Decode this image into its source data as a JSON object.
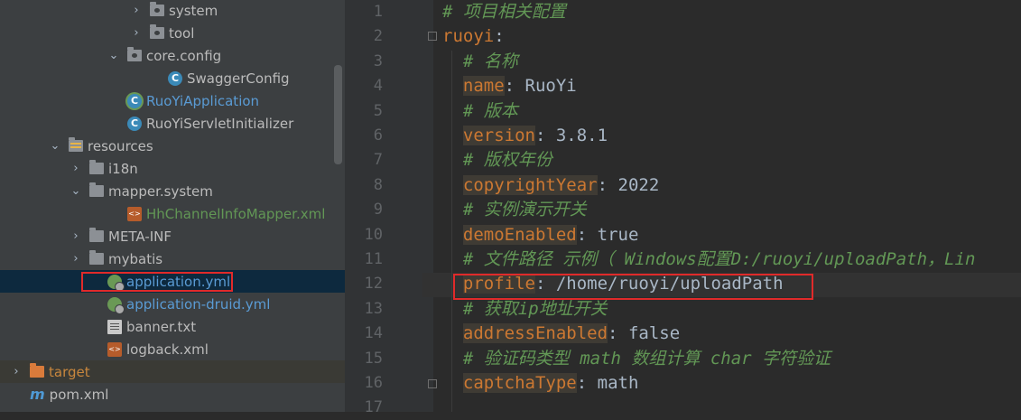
{
  "project_tree": {
    "items": [
      {
        "label": "system",
        "kind": "pkg",
        "arrow": "›",
        "style": ""
      },
      {
        "label": "tool",
        "kind": "pkg",
        "arrow": "›",
        "style": ""
      },
      {
        "label": "core.config",
        "kind": "pkg",
        "arrow": "⌄",
        "style": ""
      },
      {
        "label": "SwaggerConfig",
        "kind": "cls",
        "arrow": "",
        "style": ""
      },
      {
        "label": "RuoYiApplication",
        "kind": "spring-cls",
        "arrow": "",
        "style": "blue"
      },
      {
        "label": "RuoYiServletInitializer",
        "kind": "cls",
        "arrow": "",
        "style": ""
      },
      {
        "label": "resources",
        "kind": "res",
        "arrow": "⌄",
        "style": ""
      },
      {
        "label": "i18n",
        "kind": "folder",
        "arrow": "›",
        "style": ""
      },
      {
        "label": "mapper.system",
        "kind": "folder",
        "arrow": "⌄",
        "style": ""
      },
      {
        "label": "HhChannelInfoMapper.xml",
        "kind": "xml",
        "arrow": "",
        "style": "green"
      },
      {
        "label": "META-INF",
        "kind": "folder",
        "arrow": "›",
        "style": ""
      },
      {
        "label": "mybatis",
        "kind": "folder",
        "arrow": "›",
        "style": ""
      },
      {
        "label": "application.yml",
        "kind": "spring",
        "arrow": "",
        "style": "blue"
      },
      {
        "label": "application-druid.yml",
        "kind": "spring",
        "arrow": "",
        "style": "blue"
      },
      {
        "label": "banner.txt",
        "kind": "txt",
        "arrow": "",
        "style": ""
      },
      {
        "label": "logback.xml",
        "kind": "xml",
        "arrow": "",
        "style": ""
      },
      {
        "label": "target",
        "kind": "folder-orange",
        "arrow": "›",
        "style": "orange"
      },
      {
        "label": "pom.xml",
        "kind": "maven",
        "arrow": "",
        "style": ""
      }
    ],
    "selected_index": 12
  },
  "editor": {
    "lines": [
      {
        "num": "1",
        "comment": "# 项目相关配置"
      },
      {
        "num": "2",
        "key": "ruoyi",
        "sep": ":",
        "top": true
      },
      {
        "num": "3",
        "comment": "# 名称"
      },
      {
        "num": "4",
        "key": "name",
        "sep": ": ",
        "value": "RuoYi"
      },
      {
        "num": "5",
        "comment": "# 版本"
      },
      {
        "num": "6",
        "key": "version",
        "sep": ": ",
        "value": "3.8.1"
      },
      {
        "num": "7",
        "comment": "# 版权年份"
      },
      {
        "num": "8",
        "key": "copyrightYear",
        "sep": ": ",
        "value": "2022"
      },
      {
        "num": "9",
        "comment": "# 实例演示开关"
      },
      {
        "num": "10",
        "key": "demoEnabled",
        "sep": ": ",
        "value": "true"
      },
      {
        "num": "11",
        "comment": "# 文件路径 示例（ Windows配置D:/ruoyi/uploadPath，Lin"
      },
      {
        "num": "12",
        "key": "profile",
        "sep": ": ",
        "value": "/home/ruoyi/uploadPath"
      },
      {
        "num": "13",
        "comment": "# 获取ip地址开关"
      },
      {
        "num": "14",
        "key": "addressEnabled",
        "sep": ": ",
        "value": "false"
      },
      {
        "num": "15",
        "comment": "# 验证码类型 math 数组计算 char 字符验证"
      },
      {
        "num": "16",
        "key": "captchaType",
        "sep": ": ",
        "value": "math"
      },
      {
        "num": "17",
        "comment": ""
      }
    ]
  }
}
